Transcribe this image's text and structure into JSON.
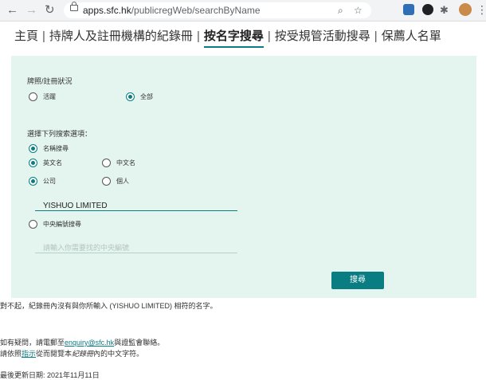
{
  "browser": {
    "url_host": "apps.sfc.hk",
    "url_path": "/publicregWeb/searchByName"
  },
  "topnav": {
    "items": [
      "主頁",
      "持牌人及註冊機構的紀錄冊",
      "按名字搜尋",
      "按受規管活動搜尋",
      "保薦人名單"
    ],
    "separator": "|",
    "active_index": 2
  },
  "form": {
    "status_label": "牌照/註冊狀況",
    "status_options": [
      "活躍",
      "全部"
    ],
    "status_selected": "全部",
    "search_type_label": "選擇下列搜索選項：",
    "by_name_label": "名稱搜尋",
    "name_lang_options": [
      "英文名",
      "中文名"
    ],
    "name_lang_selected": "英文名",
    "entity_options": [
      "公司",
      "個人"
    ],
    "entity_selected": "公司",
    "name_value": "YISHUO LIMITED",
    "by_ce_label": "中央編號搜尋",
    "ce_placeholder": "請輸入你需要找的中央編號",
    "search_button": "搜尋"
  },
  "result": {
    "no_match": "對不起，紀錄冊內沒有與你所輸入 (YISHUO LIMITED) 相符的名字。"
  },
  "contact": {
    "line1_prefix": "如有疑問，請電郵至",
    "email": "enquiry@sfc.hk",
    "line1_suffix": "與證監會聯絡。",
    "line2_prefix": "請依照",
    "guide_link": "指示",
    "line2_mid": "從而閱覽本",
    "register_italic": "紀錄冊",
    "line2_suffix": "內的中文字符。"
  },
  "footer": {
    "last_updated": "最後更新日期: 2021年11月11日"
  },
  "colors": {
    "accent": "#0a7d83",
    "panel_bg": "#e4f4ef"
  }
}
